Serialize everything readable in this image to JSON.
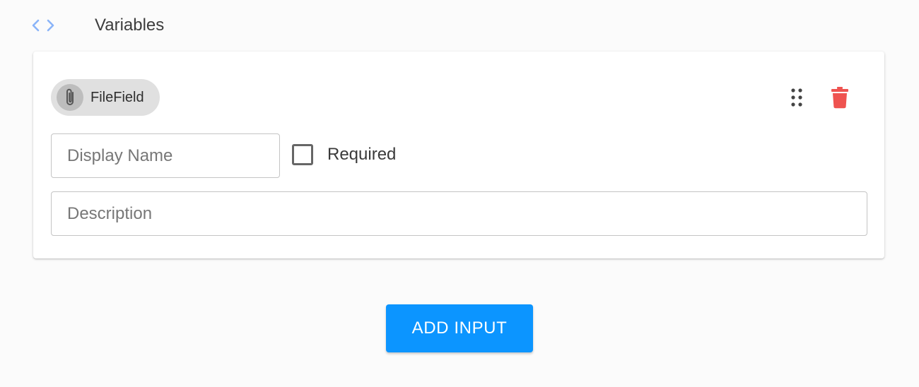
{
  "header": {
    "title": "Variables",
    "icon": "code-icon",
    "icon_color": "#8ab4f8"
  },
  "card": {
    "chip": {
      "label": "FileField",
      "icon": "paperclip-icon"
    },
    "actions": {
      "drag_icon": "drag-handle-icon",
      "delete_icon": "trash-icon",
      "delete_color": "#ef5350"
    },
    "display_name": {
      "placeholder": "Display Name",
      "value": ""
    },
    "required": {
      "label": "Required",
      "checked": false
    },
    "description": {
      "placeholder": "Description",
      "value": ""
    }
  },
  "add_button": {
    "label": "ADD INPUT",
    "color": "#0c95ff"
  }
}
